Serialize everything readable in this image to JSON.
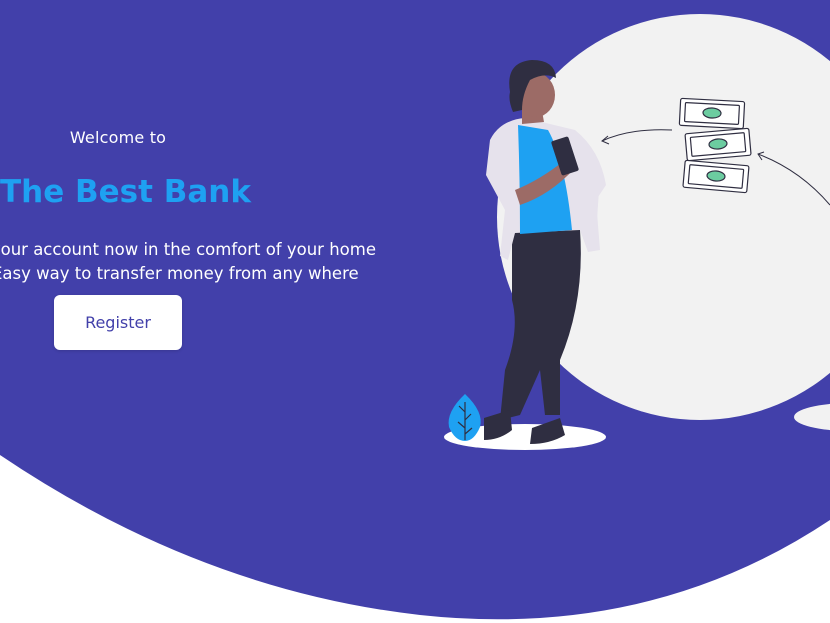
{
  "hero": {
    "welcome": "Welcome to",
    "brand_name": "The Best Bank",
    "tagline_line1": "Open your account now in the comfort of your home",
    "tagline_line2": "Easy way to transfer money from any where",
    "register_label": "Register"
  },
  "colors": {
    "primary_bg": "#4240aa",
    "brand_blue": "#1ea1f2",
    "circle": "#f2f2f2",
    "figure_shirt": "#1ea1f2",
    "figure_pants": "#2f2e41"
  }
}
